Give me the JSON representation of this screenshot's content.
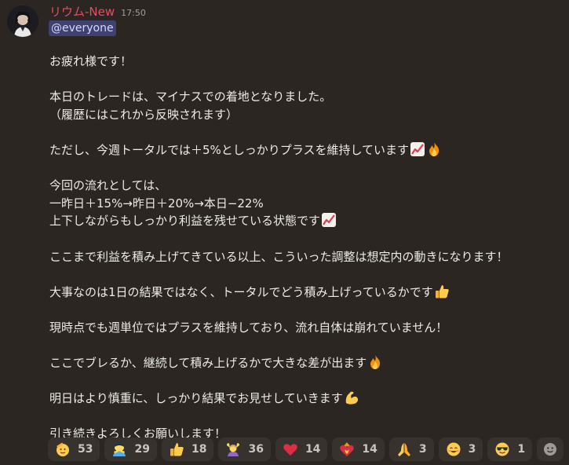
{
  "message": {
    "username": "リウム-New",
    "timestamp": "17:50",
    "mention": "@everyone",
    "lines": {
      "l1": "お疲れ様です！",
      "l2": "本日のトレードは、マイナスでの着地となりました。",
      "l3": "（履歴にはこれから反映されます）",
      "l4": "ただし、今週トータルでは＋5%としっかりプラスを維持しています",
      "l5": "今回の流れとしては、",
      "l6": "一昨日＋15%→昨日＋20%→本日−22%",
      "l7": "上下しながらもしっかり利益を残せている状態です",
      "l8": "ここまで利益を積み上げてきている以上、こういった調整は想定内の動きになります！",
      "l9": "大事なのは1日の結果ではなく、トータルでどう積み上げっているかです",
      "l10": "現時点でも週単位ではプラスを維持しており、流れ自体は崩れていません！",
      "l11": "ここでブレるか、継続して積み上げるかで大きな差が出ます",
      "l12": "明日はより慎重に、しっかり結果でお見せしていきます",
      "l13": "引き続きよろしくお願いします！"
    }
  },
  "reactions": [
    {
      "icon": "saluting-face-icon",
      "count": "53"
    },
    {
      "icon": "person-bowing-icon",
      "count": "29"
    },
    {
      "icon": "thumbs-up-icon",
      "count": "18"
    },
    {
      "icon": "person-gesturing-ok-icon",
      "count": "36"
    },
    {
      "icon": "red-heart-icon",
      "count": "14"
    },
    {
      "icon": "heart-on-fire-icon",
      "count": "14"
    },
    {
      "icon": "folded-hands-icon",
      "count": "3"
    },
    {
      "icon": "smiling-face-icon",
      "count": "3"
    },
    {
      "icon": "sunglasses-face-icon",
      "count": "1"
    },
    {
      "icon": "add-reaction-icon",
      "count": ""
    }
  ],
  "colors": {
    "background": "#2c2622",
    "username": "#e94a66",
    "mention_bg": "#3f4171",
    "mention_text": "#d6d9ff",
    "reaction_bg": "#38322e"
  }
}
